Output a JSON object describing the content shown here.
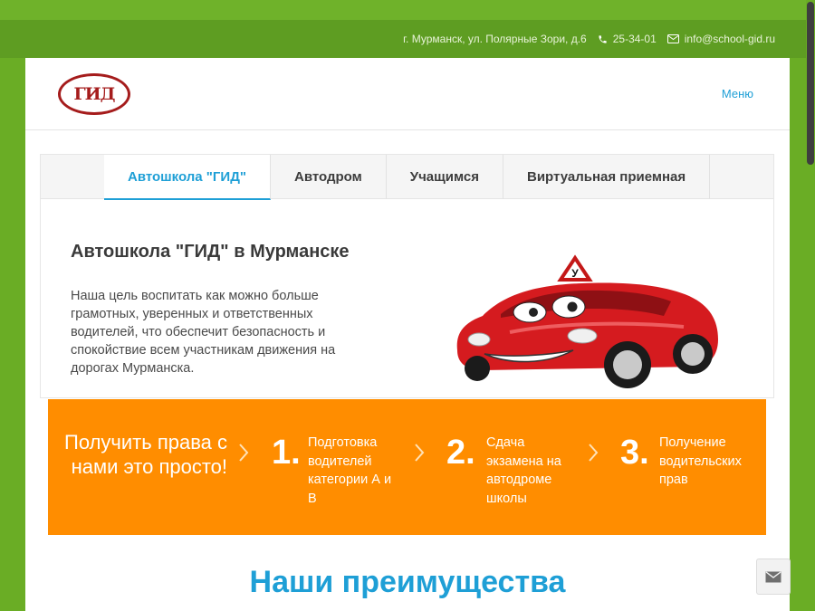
{
  "topbar": {
    "address": "г. Мурманск, ул. Полярные Зори, д.6",
    "phone": "25-34-01",
    "email": "info@school-gid.ru"
  },
  "header": {
    "logo_text": "ГИД",
    "menu_label": "Меню"
  },
  "tabs": [
    {
      "label": "Автошкола \"ГИД\"",
      "active": true
    },
    {
      "label": "Автодром",
      "active": false
    },
    {
      "label": "Учащимся",
      "active": false
    },
    {
      "label": "Виртуальная приемная",
      "active": false
    }
  ],
  "hero": {
    "title": "Автошкола \"ГИД\" в Мурманске",
    "text": "Наша цель воспитать как можно больше грамотных, уверенных и ответственных водителей, что обеспечит безопасность и спокойствие всем участникам движения на дорогах Мурманска.",
    "sign_letter": "У"
  },
  "banner": {
    "lead": "Получить права с нами это просто!",
    "steps": [
      {
        "num": "1.",
        "text": "Подготовка водителей категории А и В"
      },
      {
        "num": "2.",
        "text": "Сдача экзамена на автодроме школы"
      },
      {
        "num": "3.",
        "text": "Получение водительских прав"
      }
    ]
  },
  "section": {
    "title": "Наши преимущества"
  },
  "colors": {
    "page_green": "#6aad25",
    "accent_blue": "#1e9fd6",
    "banner_orange": "#ff8d00",
    "logo_red": "#a51c1c"
  },
  "icons": [
    "phone-icon",
    "envelope-icon",
    "chevron-right-icon",
    "mail-icon"
  ]
}
